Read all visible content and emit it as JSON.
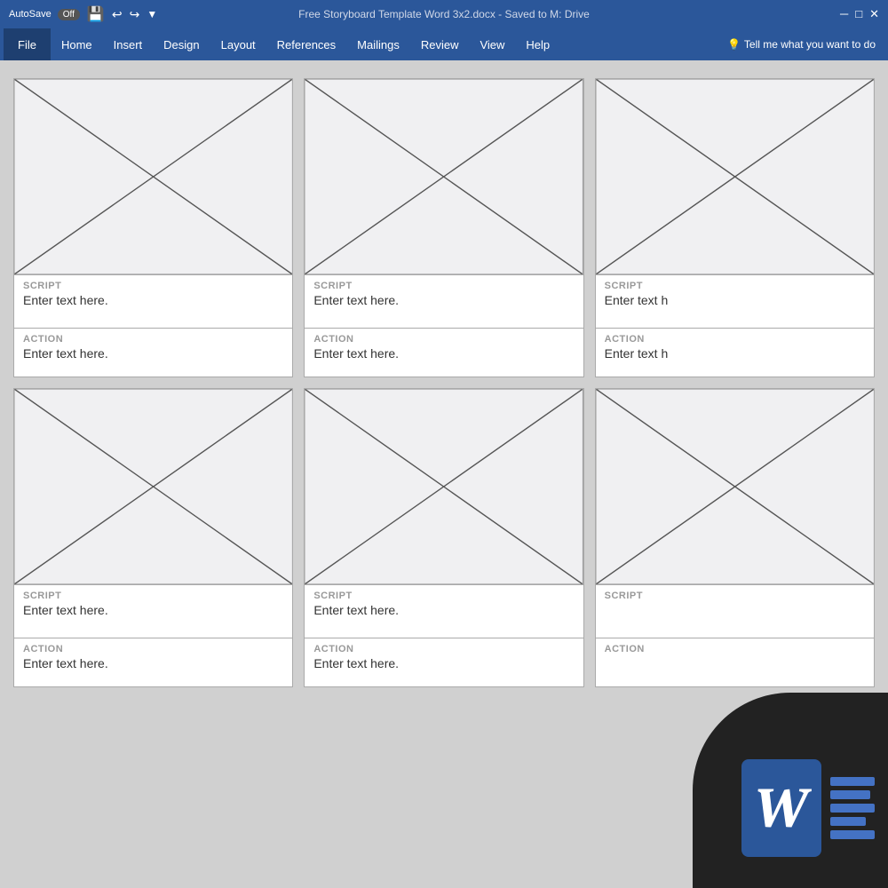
{
  "titlebar": {
    "autosave": "AutoSave",
    "autosave_state": "Off",
    "title": "Free Storyboard Template Word 3x2.docx  -  Saved to M: Drive"
  },
  "menubar": {
    "file": "File",
    "home": "Home",
    "insert": "Insert",
    "design": "Design",
    "layout": "Layout",
    "references": "References",
    "mailings": "Mailings",
    "review": "Review",
    "view": "View",
    "help": "Help",
    "tell_me": "Tell me what you want to do"
  },
  "storyboard": {
    "cells": [
      {
        "id": "cell-1",
        "script_label": "SCRIPT",
        "script_text": "Enter text here.",
        "action_label": "ACTION",
        "action_text": "Enter text here."
      },
      {
        "id": "cell-2",
        "script_label": "SCRIPT",
        "script_text": "Enter text here.",
        "action_label": "ACTION",
        "action_text": "Enter text here."
      },
      {
        "id": "cell-3",
        "script_label": "SCRIPT",
        "script_text": "Enter text h",
        "action_label": "ACTION",
        "action_text": "Enter text h"
      },
      {
        "id": "cell-4",
        "script_label": "SCRIPT",
        "script_text": "Enter text here.",
        "action_label": "ACTION",
        "action_text": "Enter text here."
      },
      {
        "id": "cell-5",
        "script_label": "SCRIPT",
        "script_text": "Enter text here.",
        "action_label": "ACTION",
        "action_text": "Enter text here."
      },
      {
        "id": "cell-6",
        "script_label": "SCRIPT",
        "script_text": "",
        "action_label": "ACTION",
        "action_text": ""
      }
    ]
  }
}
